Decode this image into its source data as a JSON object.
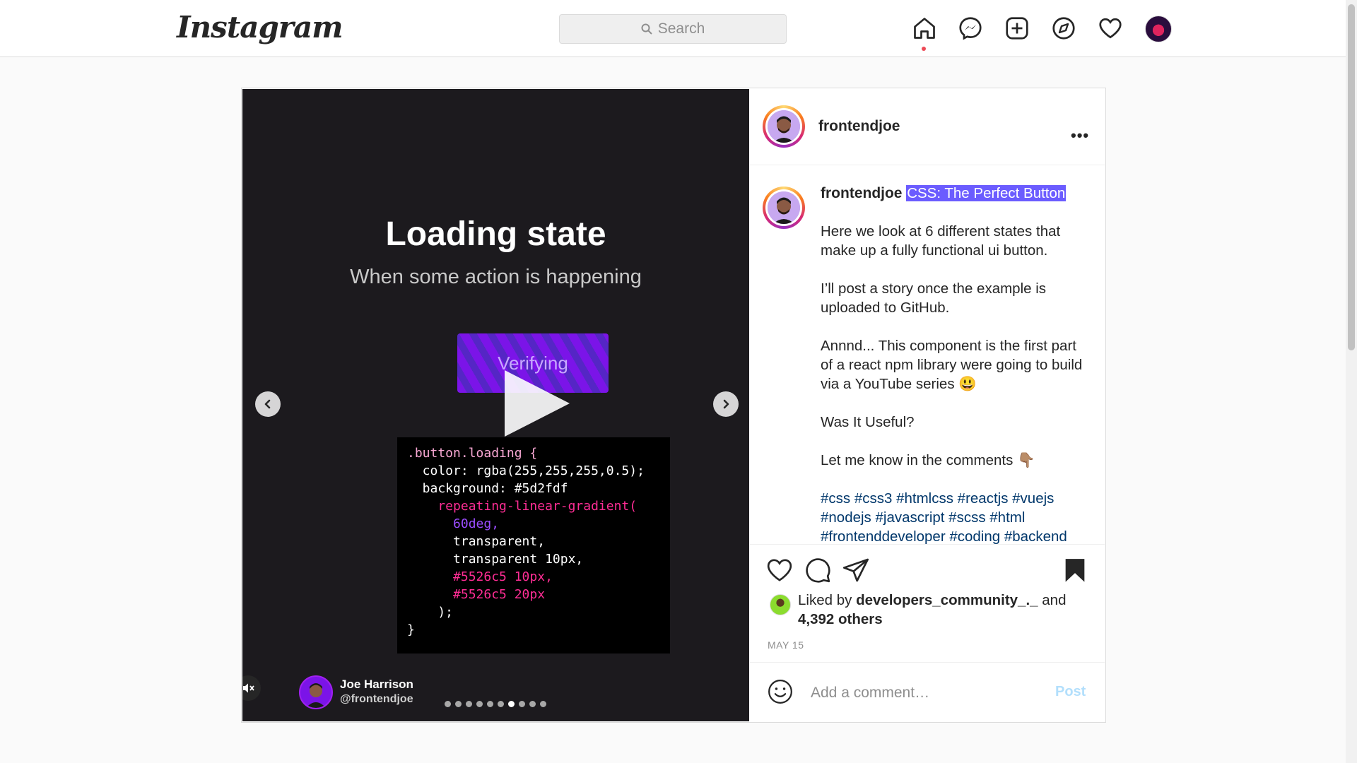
{
  "nav": {
    "logo": "Instagram",
    "search_placeholder": "Search",
    "icons": [
      "home-icon",
      "messenger-icon",
      "new-post-icon",
      "explore-icon",
      "activity-icon",
      "profile-avatar"
    ]
  },
  "media": {
    "slide_title": "Loading state",
    "slide_subtitle": "When some action is happening",
    "button_label": "Verifying",
    "code_lines": [
      ".button.loading {",
      "  color: rgba(255,255,255,0.5);",
      "  background: #5d2fdf",
      "    repeating-linear-gradient(",
      "      60deg,",
      "      transparent,",
      "      transparent 10px,",
      "      #5526c5 10px,",
      "      #5526c5 20px",
      "    );",
      "}"
    ],
    "author_name": "Joe Harrison",
    "author_handle": "@frontendjoe",
    "slide_count": 10,
    "active_slide": 7
  },
  "post": {
    "username": "frontendjoe",
    "caption_title": "CSS: The Perfect Button",
    "caption_paragraphs": [
      "Here we look at 6 different states that make up a fully functional ui button.",
      "I’ll post a story once the example is uploaded to GitHub.",
      "Annnd... This component is the first part of a react npm library were going to build via a YouTube series 😃",
      "Was It Useful?",
      "Let me know in the comments 👇🏽"
    ],
    "hashtags_line1": "#css #css3 #htmlcss #reactjs #vuejs",
    "hashtags_line2": "#nodejs #javascript #scss #html",
    "hashtags_line3": "#frontenddeveloper #coding #backend",
    "liked_by_prefix": "Liked by",
    "liked_by_user": "developers_community_._",
    "liked_by_and": "and",
    "liked_by_others": "4,392 others",
    "date": "MAY 15",
    "comment_placeholder": "Add a comment…",
    "post_button": "Post"
  },
  "colors": {
    "accent_highlight": "#6b5cff",
    "hashtag": "#00376b",
    "post_button_disabled": "#b2dffc",
    "notification_dot": "#ed4956"
  }
}
